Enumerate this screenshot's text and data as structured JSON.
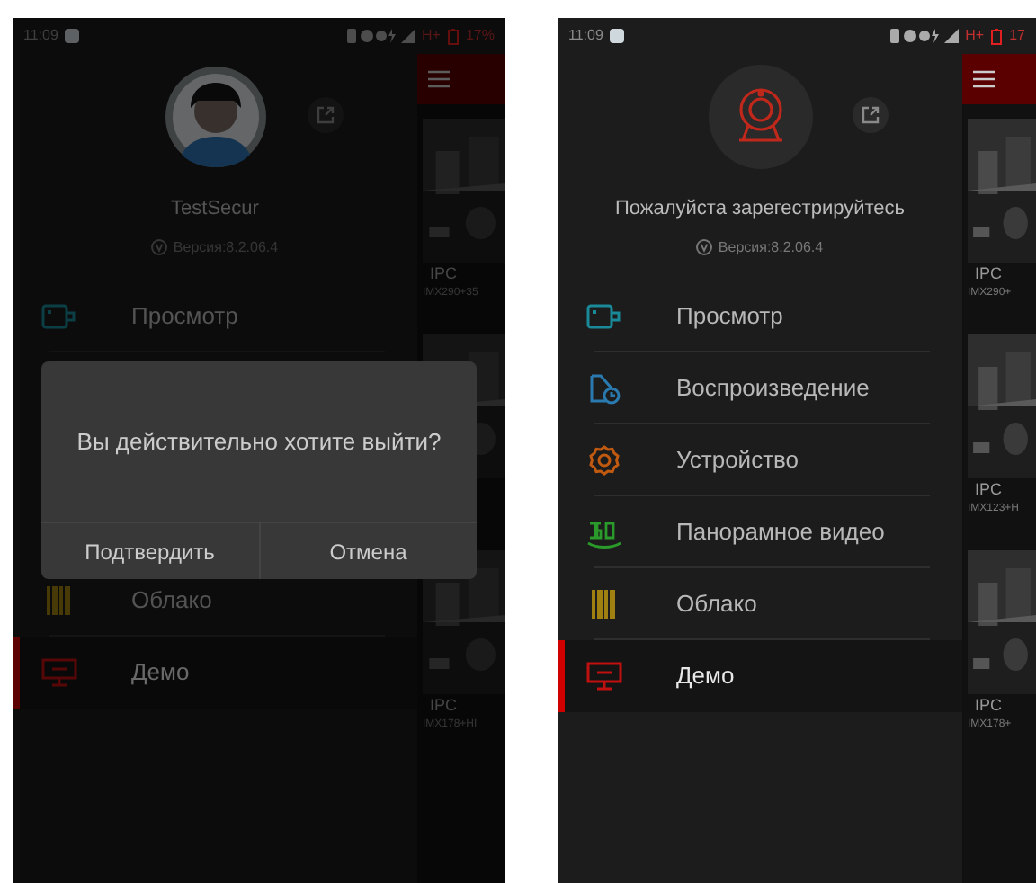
{
  "screens": [
    {
      "status_bar": {
        "time": "11:09",
        "network": "H+",
        "battery": "17%"
      },
      "profile": {
        "kind": "avatar",
        "name": "TestSecur",
        "version": "Версия:8.2.06.4"
      },
      "menu": [
        {
          "label": "Просмотр",
          "kind": "camera",
          "selected": false
        },
        {
          "label": "Облако",
          "kind": "cloud",
          "selected": false
        },
        {
          "label": "Демо",
          "kind": "demo",
          "selected": true
        }
      ],
      "cameras": [
        {
          "kind": "picture",
          "title": "IPC",
          "model": "IMX290+35"
        },
        {
          "kind": "picture"
        },
        {
          "kind": "picture",
          "title": "IPC",
          "model": "IMX178+HI"
        }
      ],
      "dimmed": true,
      "dialog": {
        "message": "Вы действительно хотите выйти?",
        "buttons": [
          "Подтвердить",
          "Отмена"
        ]
      }
    },
    {
      "status_bar": {
        "time": "11:09",
        "network": "H+",
        "battery": "17"
      },
      "profile": {
        "kind": "webcam",
        "name": "Пожалуйста зарегестрируйтесь",
        "version": "Версия:8.2.06.4"
      },
      "menu": [
        {
          "label": "Просмотр",
          "kind": "camera",
          "selected": false
        },
        {
          "label": "Воспроизведение",
          "kind": "playback",
          "selected": false
        },
        {
          "label": "Устройство",
          "kind": "device",
          "selected": false
        },
        {
          "label": "Панорамное видео",
          "kind": "panorama",
          "selected": false
        },
        {
          "label": "Облако",
          "kind": "cloud",
          "selected": false
        },
        {
          "label": "Демо",
          "kind": "demo",
          "selected": true
        }
      ],
      "cameras": [
        {
          "kind": "picture",
          "title": "IPC",
          "model": "IMX290+"
        },
        {
          "kind": "picture",
          "title": "IPC",
          "model": "IMX123+H"
        },
        {
          "kind": "picture",
          "title": "IPC",
          "model": "IMX178+"
        }
      ]
    }
  ]
}
